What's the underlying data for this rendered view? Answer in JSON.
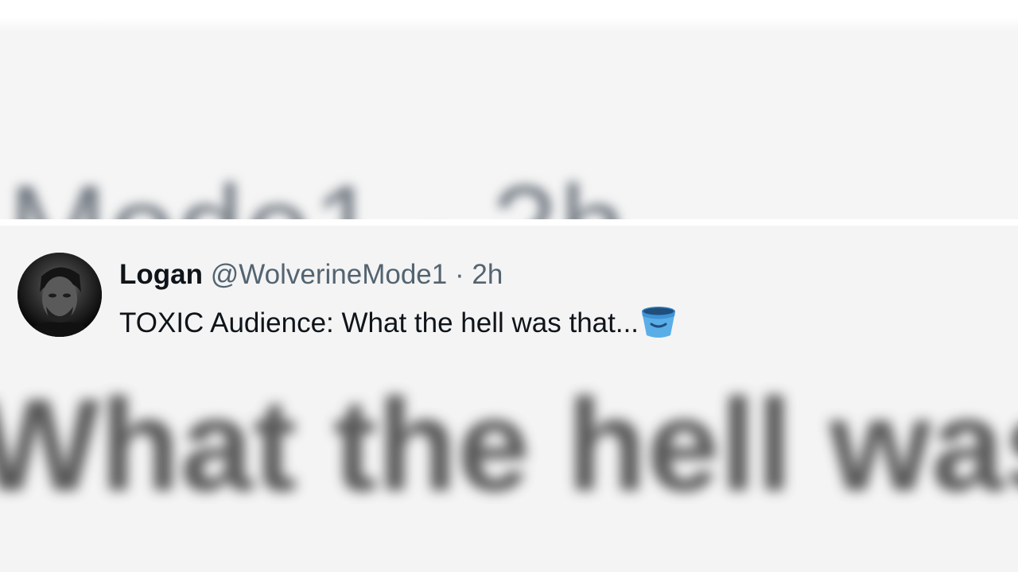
{
  "background": {
    "top_blurred_text": "Mode1 · 2h",
    "bottom_blurred_text": "What the hell was"
  },
  "tweet": {
    "author_name": "Logan",
    "handle": "@WolverineMode1",
    "separator": "·",
    "timestamp": "2h",
    "text": "TOXIC Audience: What the hell was that...",
    "emoji": "bucket-icon",
    "avatar": "profile-avatar"
  },
  "colors": {
    "name": "#0f1419",
    "meta": "#536471",
    "background": "#f4f4f4",
    "emoji_bucket": "#4a9edb"
  }
}
